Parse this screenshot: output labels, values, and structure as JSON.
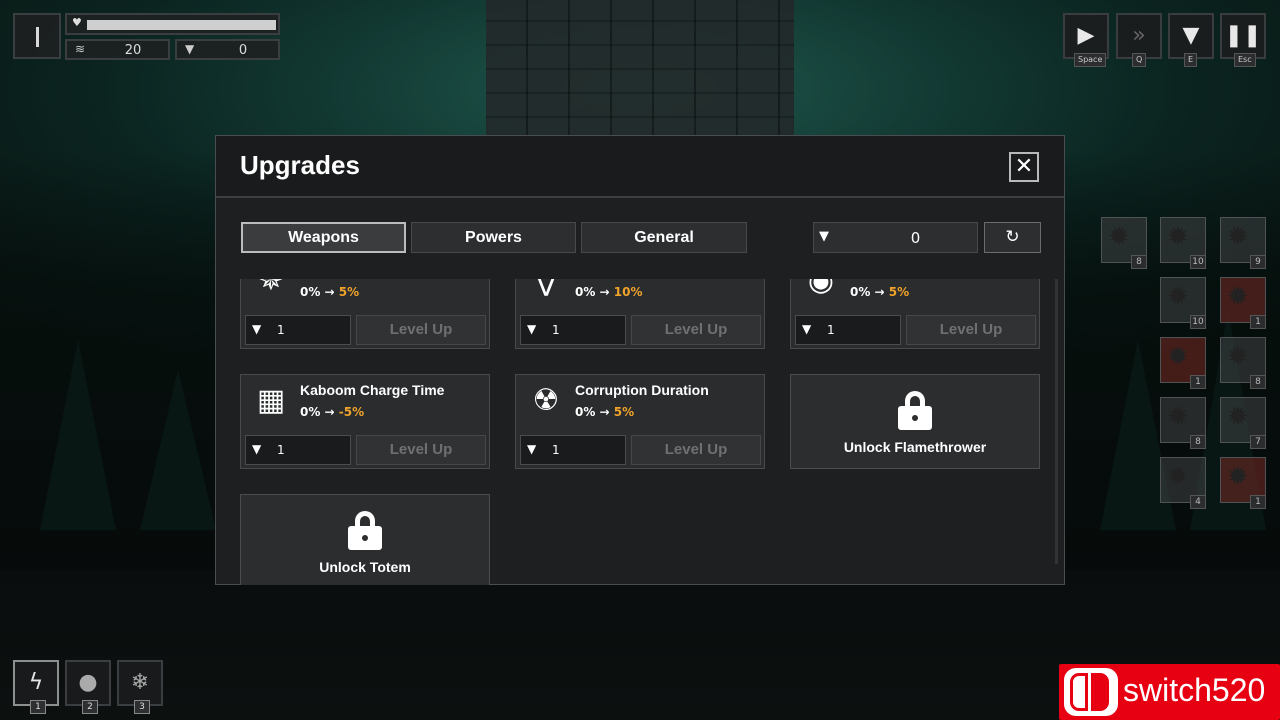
{
  "hud": {
    "coins": "20",
    "scrap": "0"
  },
  "controls": {
    "play_key": "Space",
    "fast_key": "Q",
    "upgrade_key": "E",
    "pause_key": "Esc"
  },
  "panel": {
    "title": "Upgrades",
    "close": "✕",
    "tabs": [
      "Weapons",
      "Powers",
      "General"
    ],
    "active_tab": "Weapons",
    "currency": "0",
    "reset": "↻"
  },
  "cards": [
    {
      "name": "",
      "from": "0%",
      "to": "5%",
      "cost": "1",
      "action": "Level Up"
    },
    {
      "name": "",
      "from": "0%",
      "to": "10%",
      "cost": "1",
      "action": "Level Up"
    },
    {
      "name": "",
      "from": "0%",
      "to": "5%",
      "cost": "1",
      "action": "Level Up"
    },
    {
      "name": "Kaboom Charge Time",
      "from": "0%",
      "to": "-5%",
      "cost": "1",
      "action": "Level Up"
    },
    {
      "name": "Corruption Duration",
      "from": "0%",
      "to": "5%",
      "cost": "1",
      "action": "Level Up"
    }
  ],
  "locked": [
    {
      "label": "Unlock Flamethrower"
    },
    {
      "label": "Unlock Totem"
    }
  ],
  "enemies": [
    {
      "count": "8",
      "highlight": false
    },
    {
      "count": "10",
      "highlight": false
    },
    {
      "count": "9",
      "highlight": false
    },
    {
      "count": "10",
      "highlight": false
    },
    {
      "count": "1",
      "highlight": true
    },
    {
      "count": "1",
      "highlight": true
    },
    {
      "count": "8",
      "highlight": false
    },
    {
      "count": "8",
      "highlight": false
    },
    {
      "count": "7",
      "highlight": false
    },
    {
      "count": "4",
      "highlight": false
    },
    {
      "count": "1",
      "highlight": true
    }
  ],
  "abilities": [
    {
      "num": "1",
      "icon": "lightning-icon"
    },
    {
      "num": "2",
      "icon": "bomb-icon"
    },
    {
      "num": "3",
      "icon": "snowflake-icon"
    }
  ],
  "watermark": "switch520",
  "colors": {
    "accent": "#f0a32a",
    "watermark": "#e60012"
  }
}
